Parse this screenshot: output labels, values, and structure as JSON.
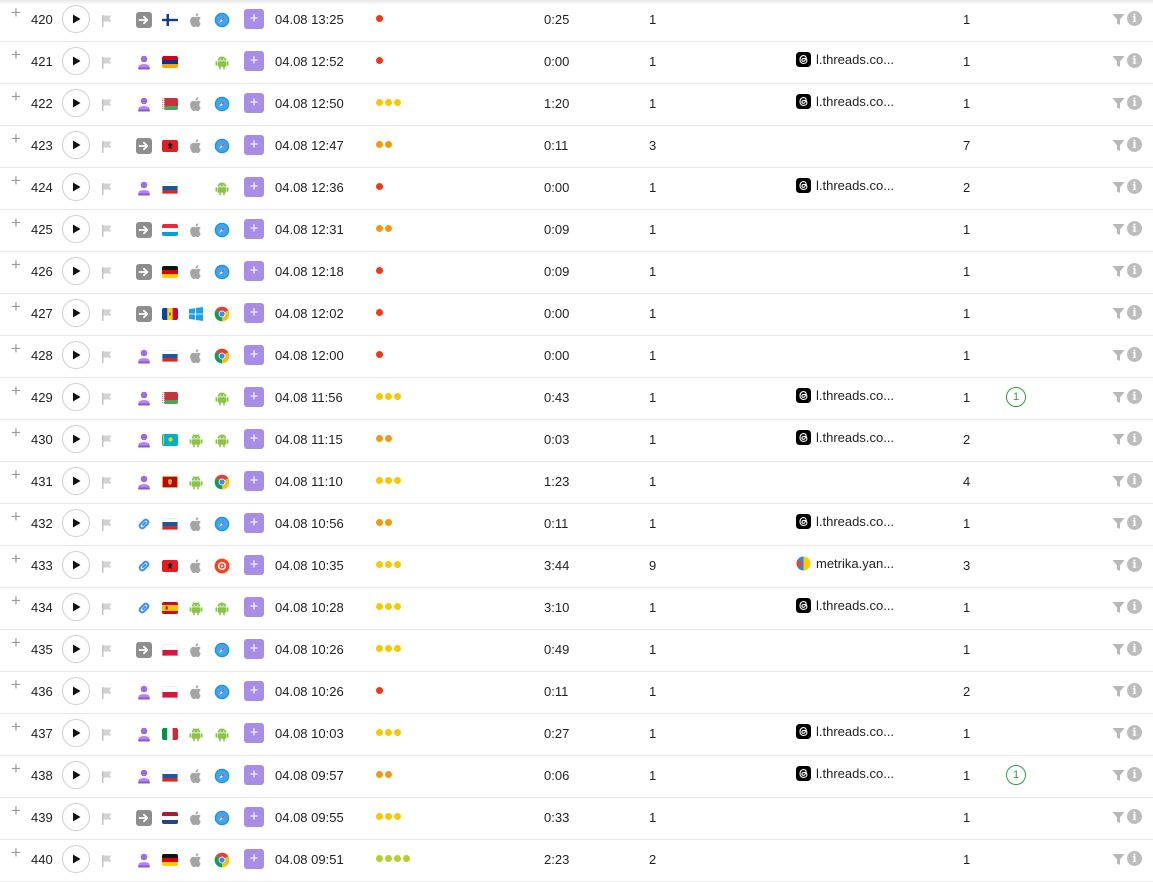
{
  "colors": {
    "accent_purple": "#a88de6",
    "dot_red": "#f03a17",
    "dot_orange": "#f29a0e",
    "dot_yellow": "#f5c800",
    "dot_lime": "#b6cf2c",
    "goal_green": "#2f9e3d"
  },
  "icons": {
    "expand": "+",
    "add": "+",
    "info": "i",
    "play": "play-icon",
    "flag": "flag-icon",
    "filter": "filter-icon"
  },
  "rows": [
    {
      "num": "420",
      "src": "direct",
      "country": "FI",
      "os": "apple",
      "browser": "safari",
      "datetime": "04.08 13:25",
      "dot_color": "red",
      "dots": 1,
      "duration": "0:25",
      "pages": "1",
      "ref_icon": "",
      "ref": "",
      "visits": "1",
      "goal": ""
    },
    {
      "num": "421",
      "src": "social",
      "country": "AM",
      "os": "",
      "browser": "android",
      "datetime": "04.08 12:52",
      "dot_color": "red",
      "dots": 1,
      "duration": "0:00",
      "pages": "1",
      "ref_icon": "threads",
      "ref": "l.threads.co...",
      "visits": "1",
      "goal": ""
    },
    {
      "num": "422",
      "src": "social",
      "country": "BY",
      "os": "apple",
      "browser": "safari",
      "datetime": "04.08 12:50",
      "dot_color": "yellow",
      "dots": 3,
      "duration": "1:20",
      "pages": "1",
      "ref_icon": "threads",
      "ref": "l.threads.co...",
      "visits": "1",
      "goal": ""
    },
    {
      "num": "423",
      "src": "direct",
      "country": "AL",
      "os": "apple",
      "browser": "safari",
      "datetime": "04.08 12:47",
      "dot_color": "orange",
      "dots": 2,
      "duration": "0:11",
      "pages": "3",
      "ref_icon": "",
      "ref": "",
      "visits": "7",
      "goal": ""
    },
    {
      "num": "424",
      "src": "social",
      "country": "RU",
      "os": "",
      "browser": "android",
      "datetime": "04.08 12:36",
      "dot_color": "red",
      "dots": 1,
      "duration": "0:00",
      "pages": "1",
      "ref_icon": "threads",
      "ref": "l.threads.co...",
      "visits": "2",
      "goal": ""
    },
    {
      "num": "425",
      "src": "direct",
      "country": "LU",
      "os": "apple",
      "browser": "safari",
      "datetime": "04.08 12:31",
      "dot_color": "orange",
      "dots": 2,
      "duration": "0:09",
      "pages": "1",
      "ref_icon": "",
      "ref": "",
      "visits": "1",
      "goal": ""
    },
    {
      "num": "426",
      "src": "direct",
      "country": "DE",
      "os": "apple",
      "browser": "safari",
      "datetime": "04.08 12:18",
      "dot_color": "red",
      "dots": 1,
      "duration": "0:09",
      "pages": "1",
      "ref_icon": "",
      "ref": "",
      "visits": "1",
      "goal": ""
    },
    {
      "num": "427",
      "src": "direct",
      "country": "MD",
      "os": "windows",
      "browser": "chrome",
      "datetime": "04.08 12:02",
      "dot_color": "red",
      "dots": 1,
      "duration": "0:00",
      "pages": "1",
      "ref_icon": "",
      "ref": "",
      "visits": "1",
      "goal": ""
    },
    {
      "num": "428",
      "src": "social",
      "country": "RU",
      "os": "apple",
      "browser": "chrome",
      "datetime": "04.08 12:00",
      "dot_color": "red",
      "dots": 1,
      "duration": "0:00",
      "pages": "1",
      "ref_icon": "",
      "ref": "",
      "visits": "1",
      "goal": ""
    },
    {
      "num": "429",
      "src": "social",
      "country": "BY",
      "os": "",
      "browser": "android",
      "datetime": "04.08 11:56",
      "dot_color": "yellow",
      "dots": 3,
      "duration": "0:43",
      "pages": "1",
      "ref_icon": "threads",
      "ref": "l.threads.co...",
      "visits": "1",
      "goal": "1"
    },
    {
      "num": "430",
      "src": "social",
      "country": "KZ",
      "os": "android",
      "browser": "android",
      "datetime": "04.08 11:15",
      "dot_color": "orange",
      "dots": 2,
      "duration": "0:03",
      "pages": "1",
      "ref_icon": "threads",
      "ref": "l.threads.co...",
      "visits": "2",
      "goal": ""
    },
    {
      "num": "431",
      "src": "social",
      "country": "ME",
      "os": "android",
      "browser": "chrome",
      "datetime": "04.08 11:10",
      "dot_color": "yellow",
      "dots": 3,
      "duration": "1:23",
      "pages": "1",
      "ref_icon": "",
      "ref": "",
      "visits": "4",
      "goal": ""
    },
    {
      "num": "432",
      "src": "link",
      "country": "RU",
      "os": "apple",
      "browser": "safari",
      "datetime": "04.08 10:56",
      "dot_color": "orange",
      "dots": 2,
      "duration": "0:11",
      "pages": "1",
      "ref_icon": "threads",
      "ref": "l.threads.co...",
      "visits": "1",
      "goal": ""
    },
    {
      "num": "433",
      "src": "link",
      "country": "AL",
      "os": "apple",
      "browser": "yandex",
      "datetime": "04.08 10:35",
      "dot_color": "yellow",
      "dots": 3,
      "duration": "3:44",
      "pages": "9",
      "ref_icon": "metrika",
      "ref": "metrika.yan...",
      "visits": "3",
      "goal": ""
    },
    {
      "num": "434",
      "src": "link",
      "country": "ES",
      "os": "android",
      "browser": "android",
      "datetime": "04.08 10:28",
      "dot_color": "yellow",
      "dots": 3,
      "duration": "3:10",
      "pages": "1",
      "ref_icon": "threads",
      "ref": "l.threads.co...",
      "visits": "1",
      "goal": ""
    },
    {
      "num": "435",
      "src": "direct",
      "country": "PL",
      "os": "apple",
      "browser": "safari",
      "datetime": "04.08 10:26",
      "dot_color": "yellow",
      "dots": 3,
      "duration": "0:49",
      "pages": "1",
      "ref_icon": "",
      "ref": "",
      "visits": "1",
      "goal": ""
    },
    {
      "num": "436",
      "src": "social",
      "country": "PL",
      "os": "apple",
      "browser": "safari",
      "datetime": "04.08 10:26",
      "dot_color": "red",
      "dots": 1,
      "duration": "0:11",
      "pages": "1",
      "ref_icon": "",
      "ref": "",
      "visits": "2",
      "goal": ""
    },
    {
      "num": "437",
      "src": "social",
      "country": "IT",
      "os": "android",
      "browser": "android",
      "datetime": "04.08 10:03",
      "dot_color": "yellow",
      "dots": 3,
      "duration": "0:27",
      "pages": "1",
      "ref_icon": "threads",
      "ref": "l.threads.co...",
      "visits": "1",
      "goal": ""
    },
    {
      "num": "438",
      "src": "social",
      "country": "RU",
      "os": "apple",
      "browser": "safari",
      "datetime": "04.08 09:57",
      "dot_color": "orange",
      "dots": 2,
      "duration": "0:06",
      "pages": "1",
      "ref_icon": "threads",
      "ref": "l.threads.co...",
      "visits": "1",
      "goal": "1"
    },
    {
      "num": "439",
      "src": "direct",
      "country": "NL",
      "os": "apple",
      "browser": "safari",
      "datetime": "04.08 09:55",
      "dot_color": "yellow",
      "dots": 3,
      "duration": "0:33",
      "pages": "1",
      "ref_icon": "",
      "ref": "",
      "visits": "1",
      "goal": ""
    },
    {
      "num": "440",
      "src": "social",
      "country": "DE",
      "os": "apple",
      "browser": "chrome",
      "datetime": "04.08 09:51",
      "dot_color": "lime",
      "dots": 4,
      "duration": "2:23",
      "pages": "2",
      "ref_icon": "",
      "ref": "",
      "visits": "1",
      "goal": ""
    }
  ]
}
